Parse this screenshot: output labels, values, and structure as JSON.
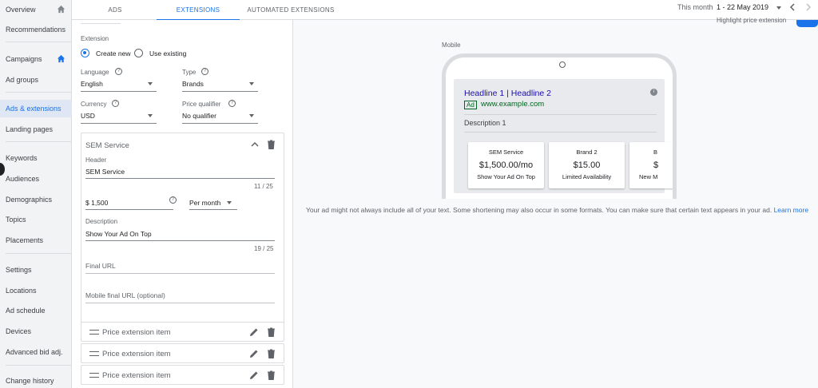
{
  "sidebar": {
    "items": [
      {
        "label": "Overview"
      },
      {
        "label": "Recommendations"
      },
      {
        "label": "Campaigns"
      },
      {
        "label": "Ad groups"
      },
      {
        "label": "Ads & extensions"
      },
      {
        "label": "Landing pages"
      },
      {
        "label": "Keywords"
      },
      {
        "label": "Audiences"
      },
      {
        "label": "Demographics"
      },
      {
        "label": "Topics"
      },
      {
        "label": "Placements"
      },
      {
        "label": "Settings"
      },
      {
        "label": "Locations"
      },
      {
        "label": "Ad schedule"
      },
      {
        "label": "Devices"
      },
      {
        "label": "Advanced bid adj."
      },
      {
        "label": "Change history"
      }
    ],
    "active": "Ads & extensions"
  },
  "tabs": [
    {
      "label": "ADS"
    },
    {
      "label": "EXTENSIONS"
    },
    {
      "label": "AUTOMATED EXTENSIONS"
    }
  ],
  "date": {
    "label": "This month",
    "range": "1 - 22 May 2019"
  },
  "form": {
    "extension_label": "Extension",
    "create_new": "Create new",
    "use_existing": "Use existing",
    "language_label": "Language",
    "language_value": "English",
    "type_label": "Type",
    "type_value": "Brands",
    "currency_label": "Currency",
    "currency_value": "USD",
    "qualifier_label": "Price qualifier",
    "qualifier_value": "No qualifier",
    "item": {
      "title": "SEM Service",
      "header_label": "Header",
      "header_value": "SEM Service",
      "header_count": "11 / 25",
      "price_value": "$ 1,500",
      "unit_value": "Per month",
      "description_label": "Description",
      "description_value": "Show Your Ad On Top",
      "description_count": "19 / 25",
      "final_url_placeholder": "Final URL",
      "mobile_url_placeholder": "Mobile final URL (optional)"
    },
    "collapsed_items": [
      "Price extension item",
      "Price extension item",
      "Price extension item"
    ]
  },
  "preview": {
    "device_label": "Mobile",
    "toggle_label": "Highlight price extension",
    "headline": "Headline 1 | Headline 2",
    "ad_badge": "Ad",
    "url": "www.example.com",
    "description": "Description 1",
    "price_cards": [
      {
        "header": "SEM Service",
        "price": "$1,500.00/mo",
        "desc": "Show Your Ad On Top"
      },
      {
        "header": "Brand 2",
        "price": "$15.00",
        "desc": "Limited Availability"
      },
      {
        "header": "B",
        "price": "$",
        "desc": "New M"
      }
    ],
    "note": "Your ad might not always include all of your text. Some shortening may also occur in some formats. You can make sure that certain text appears in your ad.",
    "learn_more": "Learn more"
  },
  "colors": {
    "accent": "#1a73e8",
    "ad_green": "#006621",
    "headline_blue": "#1a0dab"
  }
}
